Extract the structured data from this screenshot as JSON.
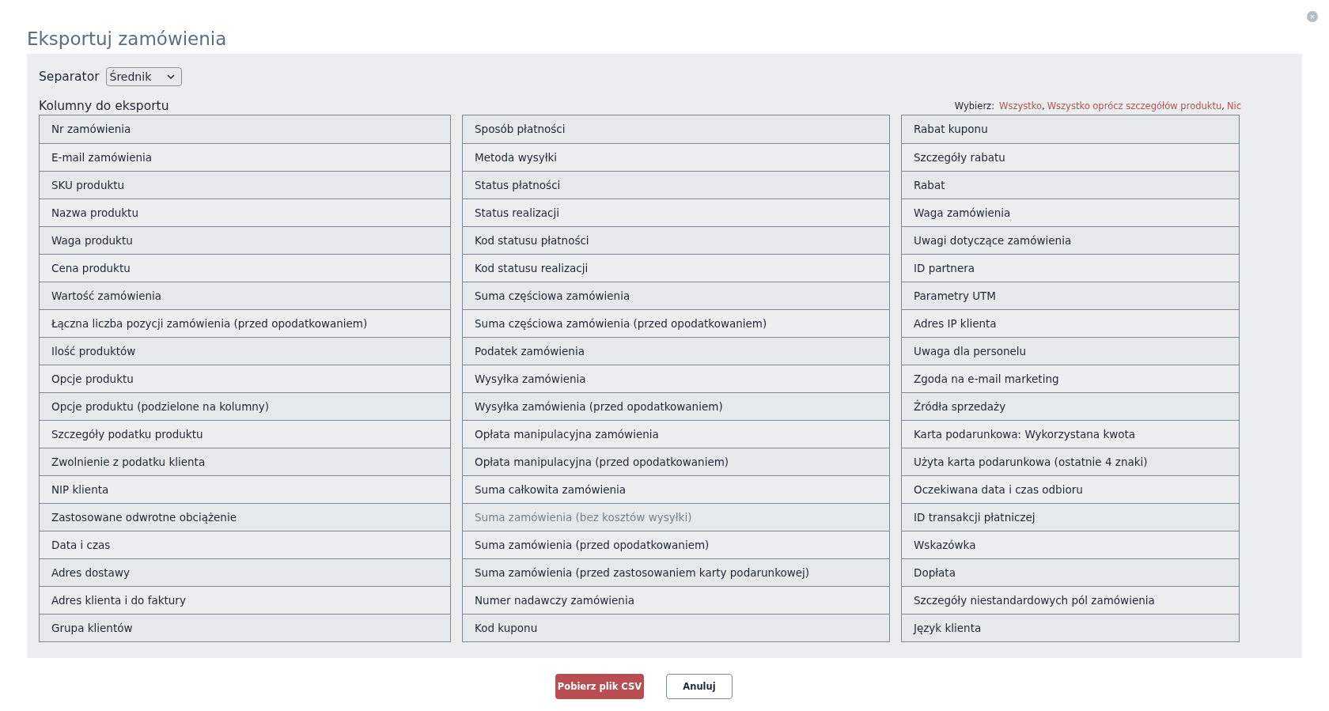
{
  "dialog": {
    "title": "Eksportuj zamówienia",
    "close_icon": "×"
  },
  "separator": {
    "label": "Separator",
    "value": "Średnik"
  },
  "columns_section": {
    "label": "Kolumny do eksportu",
    "select_label": "Wybierz:",
    "select_links": [
      "Wszystko",
      "Wszystko oprócz szczegółów produktu",
      "Nic"
    ],
    "link_separator": ","
  },
  "column_lists": [
    [
      {
        "label": "Nr zamówienia",
        "disabled": false
      },
      {
        "label": "E-mail zamówienia",
        "disabled": false
      },
      {
        "label": "SKU produktu",
        "disabled": false
      },
      {
        "label": "Nazwa produktu",
        "disabled": false
      },
      {
        "label": "Waga produktu",
        "disabled": false
      },
      {
        "label": "Cena produktu",
        "disabled": false
      },
      {
        "label": "Wartość zamówienia",
        "disabled": false
      },
      {
        "label": "Łączna liczba pozycji zamówienia (przed opodatkowaniem)",
        "disabled": false
      },
      {
        "label": "Ilość produktów",
        "disabled": false
      },
      {
        "label": "Opcje produktu",
        "disabled": false
      },
      {
        "label": "Opcje produktu (podzielone na kolumny)",
        "disabled": false
      },
      {
        "label": "Szczegóły podatku produktu",
        "disabled": false
      },
      {
        "label": "Zwolnienie z podatku klienta",
        "disabled": false
      },
      {
        "label": "NIP klienta",
        "disabled": false
      },
      {
        "label": "Zastosowane odwrotne obciążenie",
        "disabled": false
      },
      {
        "label": "Data i czas",
        "disabled": false
      },
      {
        "label": "Adres dostawy",
        "disabled": false
      },
      {
        "label": "Adres klienta i do faktury",
        "disabled": false
      },
      {
        "label": "Grupa klientów",
        "disabled": false
      }
    ],
    [
      {
        "label": "Sposób płatności",
        "disabled": false
      },
      {
        "label": "Metoda wysyłki",
        "disabled": false
      },
      {
        "label": "Status płatności",
        "disabled": false
      },
      {
        "label": "Status realizacji",
        "disabled": false
      },
      {
        "label": "Kod statusu płatności",
        "disabled": false
      },
      {
        "label": "Kod statusu realizacji",
        "disabled": false
      },
      {
        "label": "Suma częściowa zamówienia",
        "disabled": false
      },
      {
        "label": "Suma częściowa zamówienia (przed opodatkowaniem)",
        "disabled": false
      },
      {
        "label": "Podatek zamówienia",
        "disabled": false
      },
      {
        "label": "Wysyłka zamówienia",
        "disabled": false
      },
      {
        "label": "Wysyłka zamówienia (przed opodatkowaniem)",
        "disabled": false
      },
      {
        "label": "Opłata manipulacyjna zamówienia",
        "disabled": false
      },
      {
        "label": "Opłata manipulacyjna (przed opodatkowaniem)",
        "disabled": false
      },
      {
        "label": "Suma całkowita zamówienia",
        "disabled": false
      },
      {
        "label": "Suma zamówienia (bez kosztów wysyłki)",
        "disabled": true
      },
      {
        "label": "Suma zamówienia (przed opodatkowaniem)",
        "disabled": false
      },
      {
        "label": "Suma zamówienia (przed zastosowaniem karty podarunkowej)",
        "disabled": false
      },
      {
        "label": "Numer nadawczy zamówienia",
        "disabled": false
      },
      {
        "label": "Kod kuponu",
        "disabled": false
      }
    ],
    [
      {
        "label": "Rabat kuponu",
        "disabled": false
      },
      {
        "label": "Szczegóły rabatu",
        "disabled": false
      },
      {
        "label": "Rabat",
        "disabled": false
      },
      {
        "label": "Waga zamówienia",
        "disabled": false
      },
      {
        "label": "Uwagi dotyczące zamówienia",
        "disabled": false
      },
      {
        "label": "ID partnera",
        "disabled": false
      },
      {
        "label": "Parametry UTM",
        "disabled": false
      },
      {
        "label": "Adres IP klienta",
        "disabled": false
      },
      {
        "label": "Uwaga dla personelu",
        "disabled": false
      },
      {
        "label": "Zgoda na e-mail marketing",
        "disabled": false
      },
      {
        "label": "Źródła sprzedaży",
        "disabled": false
      },
      {
        "label": "Karta podarunkowa: Wykorzystana kwota",
        "disabled": false
      },
      {
        "label": "Użyta karta podarunkowa (ostatnie 4 znaki)",
        "disabled": false
      },
      {
        "label": "Oczekiwana data i czas odbioru",
        "disabled": false
      },
      {
        "label": "ID transakcji płatniczej",
        "disabled": false
      },
      {
        "label": "Wskazówka",
        "disabled": false
      },
      {
        "label": "Dopłata",
        "disabled": false
      },
      {
        "label": "Szczegóły niestandardowych pól zamówienia",
        "disabled": false
      },
      {
        "label": "Język klienta",
        "disabled": false
      }
    ]
  ],
  "buttons": {
    "primary": "Pobierz plik CSV",
    "secondary": "Anuluj"
  }
}
